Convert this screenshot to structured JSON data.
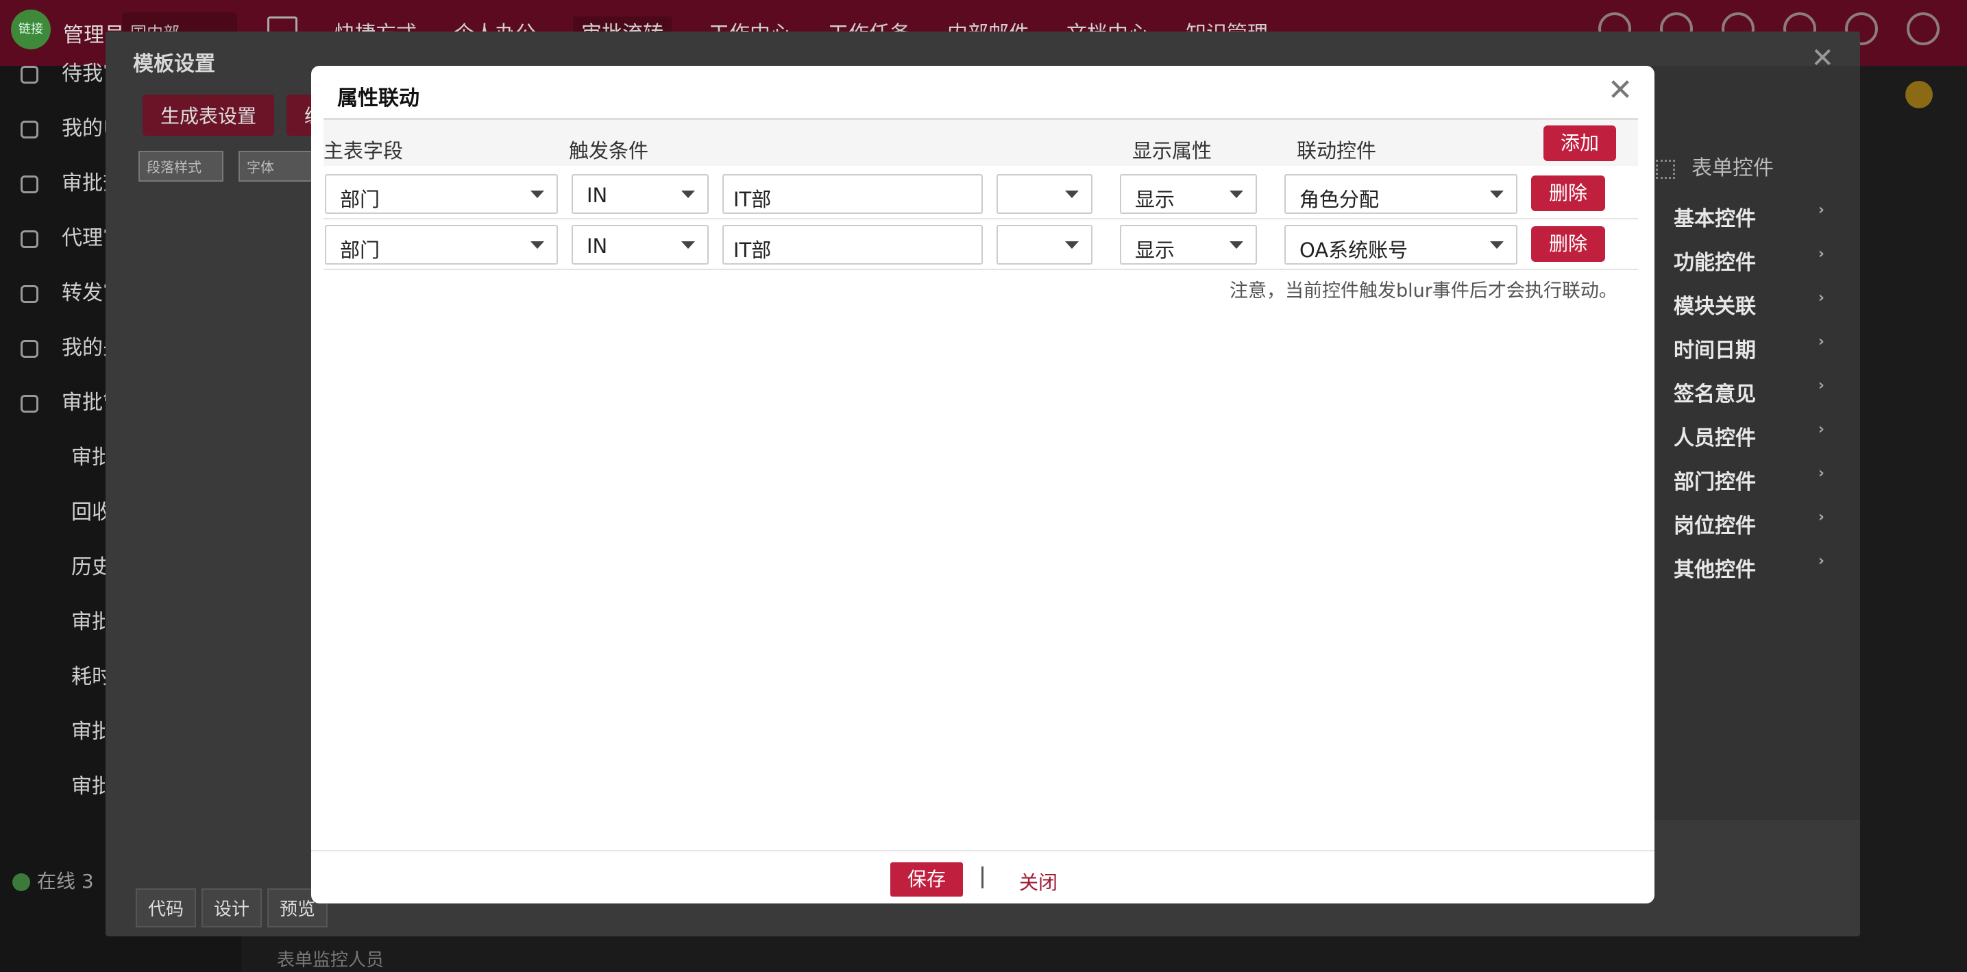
{
  "background": {
    "admin_label": "管理员",
    "site_label": "国内部",
    "top_nav": [
      "快捷方式",
      "个人办公",
      "审批流转",
      "工作中心",
      "工作任务",
      "内部邮件",
      "文档中心",
      "知识管理"
    ],
    "sidebar": {
      "items": [
        {
          "label": "待我审批",
          "icon": "inbox-icon"
        },
        {
          "label": "我的申请",
          "icon": "search-icon"
        },
        {
          "label": "审批查询",
          "icon": "search-icon"
        },
        {
          "label": "代理审批",
          "icon": "agent-icon"
        },
        {
          "label": "转发审批",
          "icon": "forward-icon"
        },
        {
          "label": "我的关注",
          "icon": "heart-icon"
        },
        {
          "label": "审批管理",
          "icon": "document-icon"
        }
      ],
      "sub_items": [
        "审批模板",
        "回收站",
        "历史审批",
        "审批统计",
        "耗时统计",
        "审批日志",
        "审批设置"
      ],
      "online": "在线 3"
    },
    "panel": {
      "title": "模板设置",
      "buttons": [
        "生成表设置",
        "编"
      ],
      "selects": [
        "段落样式",
        "字体"
      ],
      "tabs": [
        "代码",
        "设计",
        "预览"
      ],
      "bottom_text": "表单监控人员",
      "controls_title": "表单控件",
      "control_items": [
        "基本控件",
        "功能控件",
        "模块关联",
        "时间日期",
        "签名意见",
        "人员控件",
        "部门控件",
        "岗位控件",
        "其他控件"
      ]
    }
  },
  "modal": {
    "title": "属性联动",
    "columns": {
      "main_field": "主表字段",
      "trigger": "触发条件",
      "display_attr": "显示属性",
      "linked_control": "联动控件"
    },
    "add_label": "添加",
    "rows": [
      {
        "field": "部门",
        "operator": "IN",
        "value": "IT部",
        "extra": "",
        "display": "显示",
        "control": "角色分配",
        "delete_label": "删除"
      },
      {
        "field": "部门",
        "operator": "IN",
        "value": "IT部",
        "extra": "",
        "display": "显示",
        "control": "OA系统账号",
        "delete_label": "删除"
      }
    ],
    "note": "注意，当前控件触发blur事件后才会执行联动。",
    "save_label": "保存",
    "close_label": "关闭"
  },
  "colors": {
    "accent": "#c0203e",
    "topbar": "#5c0a1f"
  }
}
